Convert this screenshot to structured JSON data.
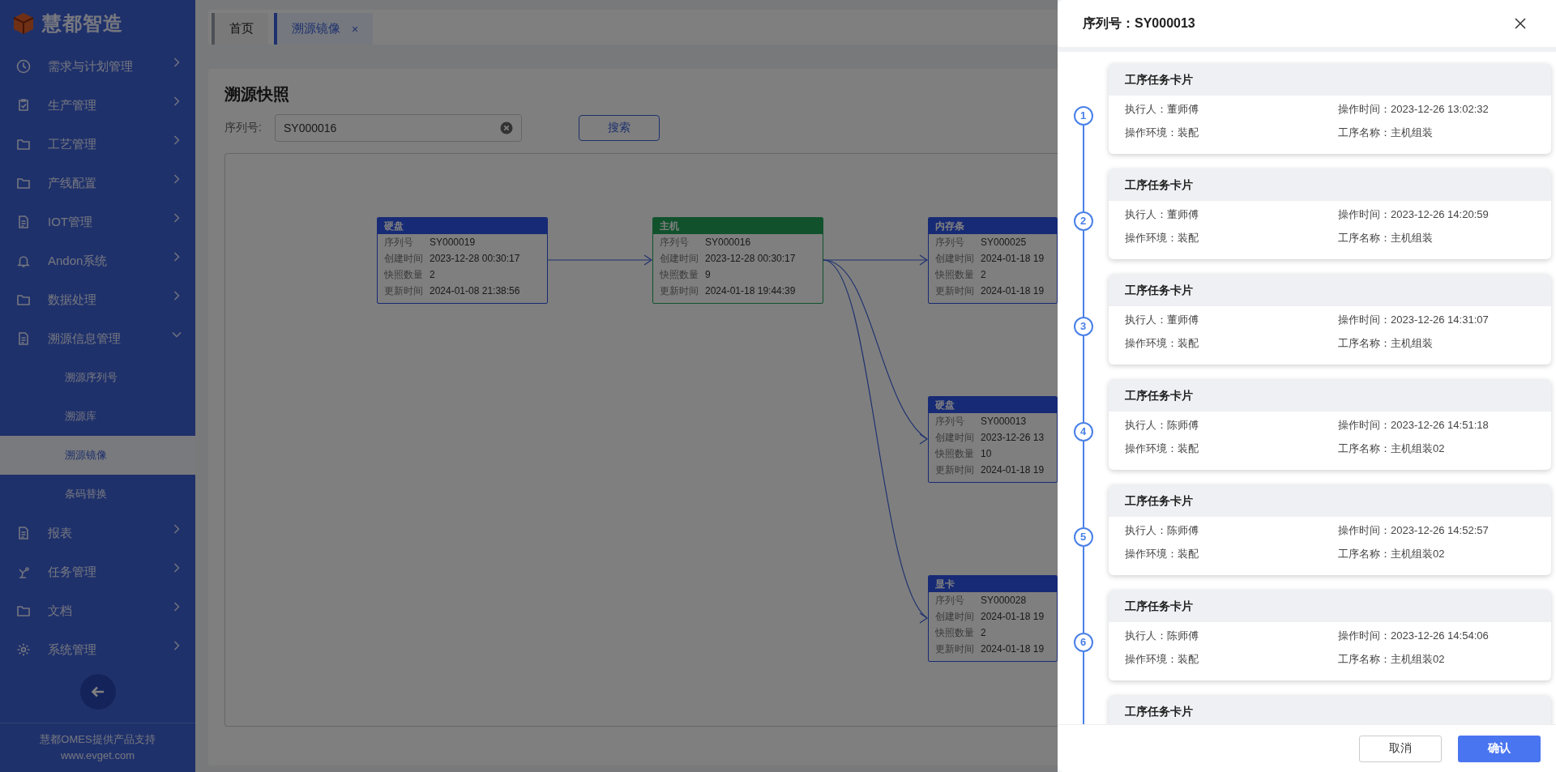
{
  "sidebar": {
    "logo": "慧都智造",
    "items": [
      {
        "label": "需求与计划管理",
        "expanded": false
      },
      {
        "label": "生产管理",
        "expanded": false
      },
      {
        "label": "工艺管理",
        "expanded": false
      },
      {
        "label": "产线配置",
        "expanded": false
      },
      {
        "label": "IOT管理",
        "expanded": false
      },
      {
        "label": "Andon系统",
        "expanded": false
      },
      {
        "label": "数据处理",
        "expanded": false
      },
      {
        "label": "溯源信息管理",
        "expanded": true,
        "children": [
          {
            "label": "溯源序列号",
            "selected": false
          },
          {
            "label": "溯源库",
            "selected": false
          },
          {
            "label": "溯源镜像",
            "selected": true
          },
          {
            "label": "条码替换",
            "selected": false
          }
        ]
      },
      {
        "label": "报表",
        "expanded": false
      },
      {
        "label": "任务管理",
        "expanded": false
      },
      {
        "label": "文档",
        "expanded": false
      },
      {
        "label": "系统管理",
        "expanded": false
      }
    ],
    "footer": [
      "慧都OMES提供产品支持",
      "www.evget.com"
    ]
  },
  "tabs": [
    {
      "label": "首页",
      "selected": false
    },
    {
      "label": "溯源镜像",
      "selected": true,
      "close": "×"
    }
  ],
  "page": {
    "title": "溯源快照",
    "search": {
      "label": "序列号:",
      "value": "SY000016"
    },
    "search_button": "搜索"
  },
  "diagram": {
    "columns": [
      [
        {
          "title": "硬盘",
          "kind": "related",
          "fields": [
            [
              "序列号",
              "SY000019"
            ],
            [
              "创建时间",
              "2023-12-28 00:30:17"
            ],
            [
              "快照数量",
              "2"
            ],
            [
              "更新时间",
              "2024-01-08 21:38:56"
            ]
          ]
        }
      ],
      [
        {
          "title": "主机",
          "kind": "current",
          "fields": [
            [
              "序列号",
              "SY000016"
            ],
            [
              "创建时间",
              "2023-12-28 00:30:17"
            ],
            [
              "快照数量",
              "9"
            ],
            [
              "更新时间",
              "2024-01-18 19:44:39"
            ]
          ]
        }
      ],
      [
        {
          "title": "内存条",
          "kind": "related",
          "fields": [
            [
              "序列号",
              "SY000025"
            ],
            [
              "创建时间",
              "2024-01-18 19"
            ],
            [
              "快照数量",
              "2"
            ],
            [
              "更新时间",
              "2024-01-18 19"
            ]
          ]
        },
        {
          "title": "硬盘",
          "kind": "related",
          "fields": [
            [
              "序列号",
              "SY000013"
            ],
            [
              "创建时间",
              "2023-12-26 13"
            ],
            [
              "快照数量",
              "10"
            ],
            [
              "更新时间",
              "2024-01-18 19"
            ]
          ]
        },
        {
          "title": "显卡",
          "kind": "related",
          "fields": [
            [
              "序列号",
              "SY000028"
            ],
            [
              "创建时间",
              "2024-01-18 19"
            ],
            [
              "快照数量",
              "2"
            ],
            [
              "更新时间",
              "2024-01-18 19"
            ]
          ]
        }
      ]
    ]
  },
  "drawer": {
    "title": "序列号：SY000013",
    "steps": [
      {
        "number": "1",
        "title": "工序任务卡片",
        "fields": [
          [
            "执行人：",
            "董师傅"
          ],
          [
            "操作时间：",
            "2023-12-26 13:02:32"
          ],
          [
            "操作环境：",
            "装配"
          ],
          [
            "工序名称：",
            "主机组装"
          ]
        ]
      },
      {
        "number": "2",
        "title": "工序任务卡片",
        "fields": [
          [
            "执行人：",
            "董师傅"
          ],
          [
            "操作时间：",
            "2023-12-26 14:20:59"
          ],
          [
            "操作环境：",
            "装配"
          ],
          [
            "工序名称：",
            "主机组装"
          ]
        ]
      },
      {
        "number": "3",
        "title": "工序任务卡片",
        "fields": [
          [
            "执行人：",
            "董师傅"
          ],
          [
            "操作时间：",
            "2023-12-26 14:31:07"
          ],
          [
            "操作环境：",
            "装配"
          ],
          [
            "工序名称：",
            "主机组装"
          ]
        ]
      },
      {
        "number": "4",
        "title": "工序任务卡片",
        "fields": [
          [
            "执行人：",
            "陈师傅"
          ],
          [
            "操作时间：",
            "2023-12-26 14:51:18"
          ],
          [
            "操作环境：",
            "装配"
          ],
          [
            "工序名称：",
            "主机组装02"
          ]
        ]
      },
      {
        "number": "5",
        "title": "工序任务卡片",
        "fields": [
          [
            "执行人：",
            "陈师傅"
          ],
          [
            "操作时间：",
            "2023-12-26 14:52:57"
          ],
          [
            "操作环境：",
            "装配"
          ],
          [
            "工序名称：",
            "主机组装02"
          ]
        ]
      },
      {
        "number": "6",
        "title": "工序任务卡片",
        "fields": [
          [
            "执行人：",
            "陈师傅"
          ],
          [
            "操作时间：",
            "2023-12-26 14:54:06"
          ],
          [
            "操作环境：",
            "装配"
          ],
          [
            "工序名称：",
            "主机组装02"
          ]
        ]
      },
      {
        "title": "工序任务卡片"
      }
    ],
    "cancel": "取消",
    "confirm": "确认"
  }
}
